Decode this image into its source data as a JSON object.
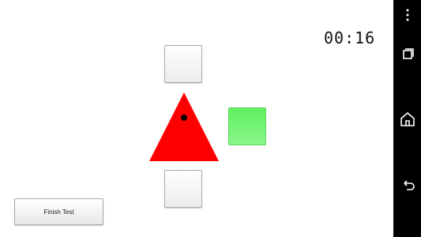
{
  "timer": {
    "text": "00:16"
  },
  "buttons": {
    "finish_label": "Finish Test"
  },
  "colors": {
    "triangle": "#ff0000",
    "active_tile": "#76f476",
    "navigation_bar": "#000000"
  },
  "icons": {
    "menu": "overflow-menu-icon",
    "recent": "recent-apps-icon",
    "home": "home-icon",
    "back": "back-icon"
  }
}
